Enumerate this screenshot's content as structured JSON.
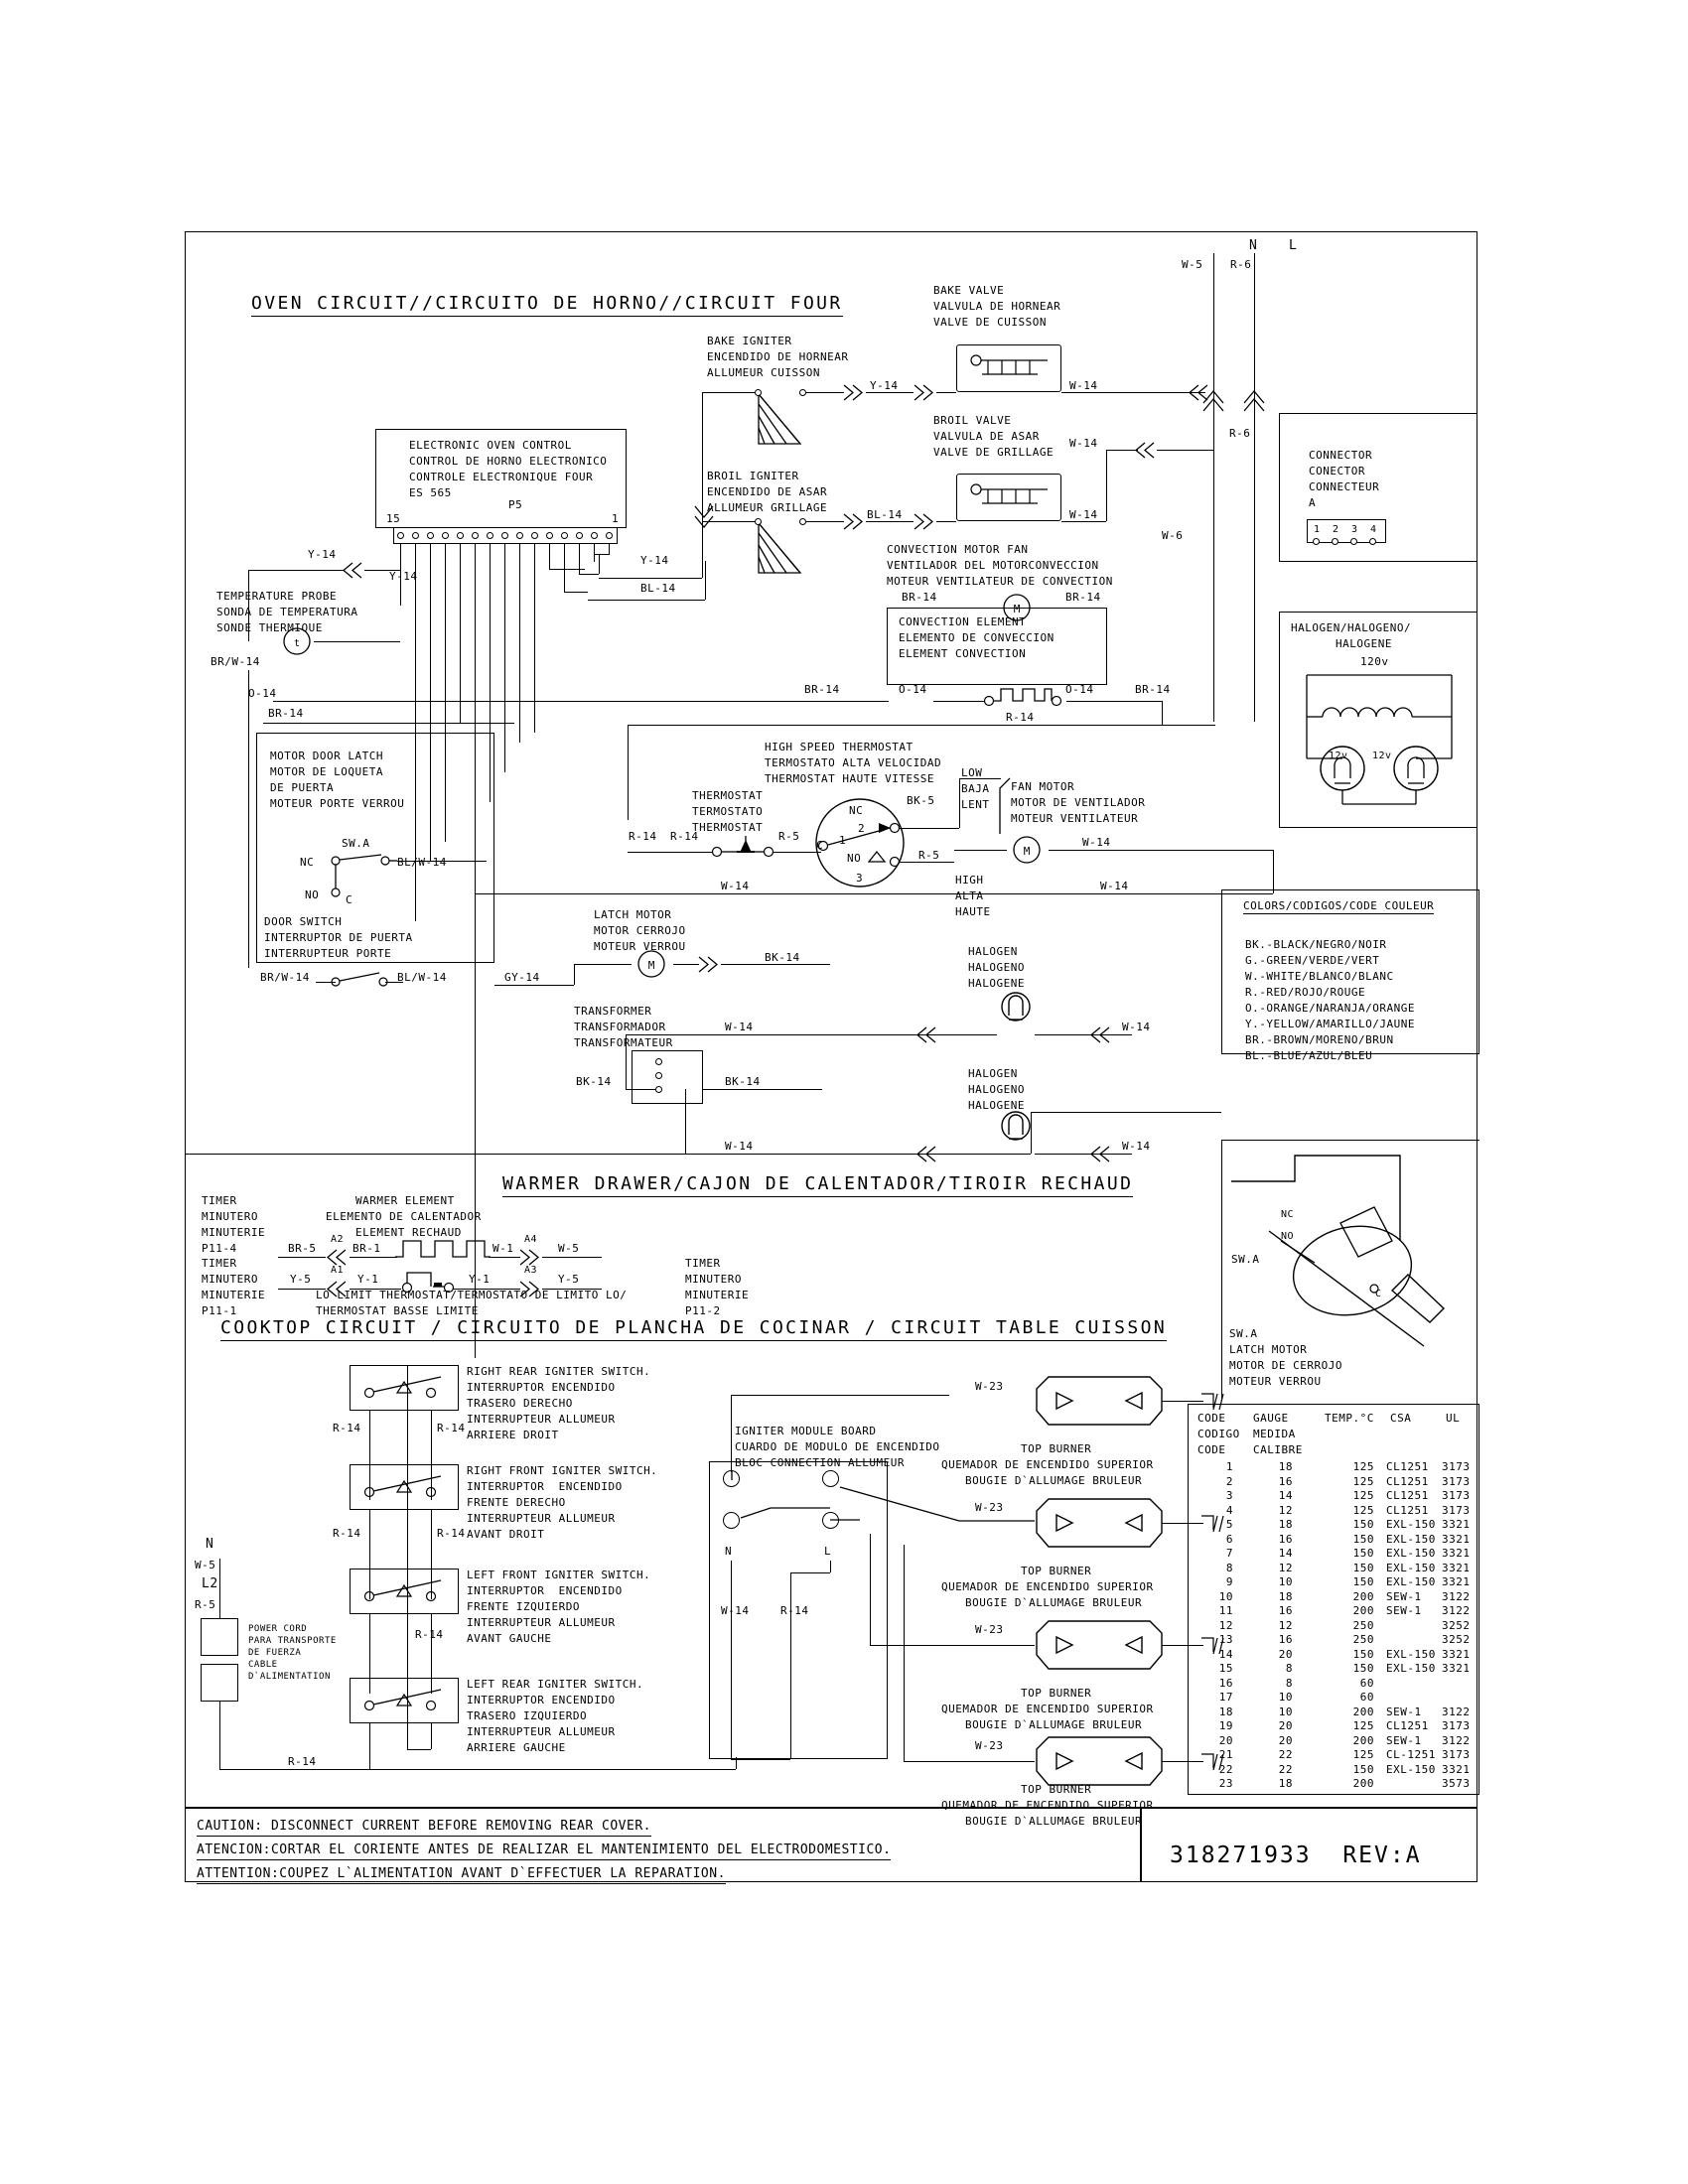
{
  "document": {
    "part_number": "318271933  REV:A",
    "caution_lines": [
      "CAUTION: DISCONNECT CURRENT BEFORE REMOVING REAR COVER.",
      "ATENCION:CORTAR EL CORIENTE ANTES DE REALIZAR EL MANTENIMIENTO DEL ELECTRODOMESTICO.",
      "ATTENTION:COUPEZ L`ALIMENTATION AVANT D`EFFECTUER LA REPARATION."
    ]
  },
  "sections": {
    "oven": "OVEN CIRCUIT//CIRCUITO DE HORNO//CIRCUIT FOUR",
    "warmer": "WARMER DRAWER/CAJON DE CALENTADOR/TIROIR RECHAUD",
    "cooktop": "COOKTOP CIRCUIT / CIRCUITO DE PLANCHA DE COCINAR / CIRCUIT TABLE CUISSON"
  },
  "supply": {
    "n": "N",
    "l": "L",
    "w5": "W-5",
    "r6": "R-6",
    "r6b": "R-6",
    "w6": "W-6"
  },
  "control": {
    "lines": [
      "ELECTRONIC OVEN CONTROL",
      "CONTROL DE HORNO ELECTRONICO",
      "CONTROLE ELECTRONIQUE FOUR",
      "ES 565"
    ],
    "pin_left": "15",
    "pin_right": "1",
    "connector_label": "P5"
  },
  "oven_labels": {
    "bake_igniter": [
      "BAKE IGNITER",
      "ENCENDIDO DE HORNEAR",
      "ALLUMEUR CUISSON"
    ],
    "broil_igniter": [
      "BROIL IGNITER",
      "ENCENDIDO DE ASAR",
      "ALLUMEUR GRILLAGE"
    ],
    "bake_valve": [
      "BAKE VALVE",
      "VALVULA DE HORNEAR",
      "VALVE DE CUISSON"
    ],
    "broil_valve": [
      "BROIL VALVE",
      "VALVULA DE ASAR",
      "VALVE DE GRILLAGE"
    ],
    "convection_motor": [
      "CONVECTION MOTOR FAN",
      "VENTILADOR DEL MOTORCONVECCION",
      "MOTEUR VENTILATEUR DE CONVECTION"
    ],
    "convection_element": [
      "CONVECTION ELEMENT",
      "ELEMENTO DE CONVECCION",
      "ELEMENT CONVECTION"
    ],
    "temperature_probe": [
      "TEMPERATURE PROBE",
      "SONDA DE TEMPERATURA",
      "SONDE THERMIQUE"
    ],
    "motor_door_latch": [
      "MOTOR DOOR LATCH",
      "MOTOR DE LOQUETA",
      "DE PUERTA",
      "MOTEUR PORTE VERROU"
    ],
    "door_switch": [
      "DOOR SWITCH",
      "INTERRUPTOR DE PUERTA",
      "INTERRUPTEUR PORTE"
    ],
    "latch_motor": [
      "LATCH MOTOR",
      "MOTOR CERROJO",
      "MOTEUR VERROU"
    ],
    "transformer": [
      "TRANSFORMER",
      "TRANSFORMADOR",
      "TRANSFORMATEUR"
    ],
    "high_speed_thermostat": [
      "HIGH SPEED THERMOSTAT",
      "TERMOSTATO ALTA VELOCIDAD",
      "THERMOSTAT HAUTE VITESSE"
    ],
    "thermostat": [
      "THERMOSTAT",
      "TERMOSTATO",
      "THERMOSTAT"
    ],
    "fan_motor": [
      "FAN MOTOR",
      "MOTOR DE VENTILADOR",
      "MOTEUR VENTILATEUR"
    ],
    "low": [
      "LOW",
      "BAJA",
      "LENT"
    ],
    "high": [
      "HIGH",
      "ALTA",
      "HAUTE"
    ],
    "halogen": [
      "HALOGEN",
      "HALOGENO",
      "HALOGENE"
    ],
    "sw_a": "SW.A",
    "nc": "NC",
    "no": "NO",
    "c": "C",
    "t": "t",
    "node_c": "C",
    "node_1": "1",
    "node_2": "2",
    "node_3": "3"
  },
  "wires": {
    "y14": "Y-14",
    "bl14": "BL-14",
    "w14": "W-14",
    "br14": "BR-14",
    "o14": "O-14",
    "r14": "R-14",
    "r5": "R-5",
    "bk5": "BK-5",
    "bk14": "BK-14",
    "gy14": "GY-14",
    "brw14": "BR/W-14",
    "blw14": "BL/W-14",
    "w23": "W-23",
    "w1": "W-1",
    "w5": "W-5",
    "y5": "Y-5",
    "y1": "Y-1",
    "br5": "BR-5",
    "br1": "BR-1",
    "r6": "R-6"
  },
  "connector_box": {
    "lines": [
      "CONNECTOR",
      "CONECTOR",
      "CONNECTEUR",
      "A"
    ],
    "pins": [
      "1",
      "2",
      "3",
      "4"
    ]
  },
  "halogen_box": {
    "title": "HALOGEN/HALOGENO/",
    "title2": "HALOGENE",
    "voltage": "120v",
    "v_left": "12v",
    "v_right": "12v"
  },
  "colors_legend": {
    "title": "COLORS/CODIGOS/CODE COULEUR",
    "items": [
      "BK.-BLACK/NEGRO/NOIR",
      "G.-GREEN/VERDE/VERT",
      "W.-WHITE/BLANCO/BLANC",
      "R.-RED/ROJO/ROUGE",
      "O.-ORANGE/NARANJA/ORANGE",
      "Y.-YELLOW/AMARILLO/JAUNE",
      "BR.-BROWN/MORENO/BRUN",
      "BL.-BLUE/AZUL/BLEU"
    ]
  },
  "latch_detail": {
    "sw_a": "SW.A",
    "sw_a2": "SW.A",
    "nc": "NC",
    "no": "NO",
    "c": "C",
    "lines": [
      "LATCH MOTOR",
      "MOTOR DE CERROJO",
      "MOTEUR VERROU"
    ]
  },
  "warmer": {
    "timer1": [
      "TIMER",
      "MINUTERO",
      "MINUTERIE",
      "P11-4"
    ],
    "timer2": [
      "TIMER",
      "MINUTERO",
      "MINUTERIE",
      "P11-1"
    ],
    "timer3": [
      "TIMER",
      "MINUTERO",
      "MINUTERIE",
      "P11-2"
    ],
    "element": [
      "WARMER ELEMENT",
      "ELEMENTO DE CALENTADOR",
      "ELEMENT RECHAUD"
    ],
    "lo_limit": [
      "LO LIMIT THERMOSTAT/TERMOSTATO DE LIMITO LO/",
      "THERMOSTAT BASSE LIMITE"
    ],
    "a1": "A1",
    "a2": "A2",
    "a3": "A3",
    "a4": "A4"
  },
  "cooktop": {
    "power": {
      "n": "N",
      "w5": "W-5",
      "l2": "L2",
      "r5": "R-5",
      "cord": [
        "POWER CORD",
        "PARA TRANSPORTE",
        "DE FUERZA",
        "CABLE",
        "D`ALIMENTATION"
      ]
    },
    "switches": [
      {
        "lines": [
          "RIGHT REAR IGNITER SWITCH.",
          "INTERRUPTOR ENCENDIDO",
          "TRASERO DERECHO",
          "INTERRUPTEUR ALLUMEUR",
          "ARRIERE DROIT"
        ]
      },
      {
        "lines": [
          "RIGHT FRONT IGNITER SWITCH.",
          "INTERRUPTOR  ENCENDIDO",
          "FRENTE DERECHO",
          "INTERRUPTEUR ALLUMEUR",
          "AVANT DROIT"
        ]
      },
      {
        "lines": [
          "LEFT FRONT IGNITER SWITCH.",
          "INTERRUPTOR  ENCENDIDO",
          "FRENTE IZQUIERDO",
          "INTERRUPTEUR ALLUMEUR",
          "AVANT GAUCHE"
        ]
      },
      {
        "lines": [
          "LEFT REAR IGNITER SWITCH.",
          "INTERRUPTOR ENCENDIDO",
          "TRASERO IZQUIERDO",
          "INTERRUPTEUR ALLUMEUR",
          "ARRIERE GAUCHE"
        ]
      }
    ],
    "module": {
      "lines": [
        "IGNITER MODULE BOARD",
        "CUARDO DE MODULO DE ENCENDIDO",
        "BLOC CONNECTION ALLUMEUR"
      ],
      "n": "N",
      "l": "L",
      "w14": "W-14",
      "r14": "R-14"
    },
    "burner": [
      "TOP BURNER",
      "QUEMADOR DE ENCENDIDO SUPERIOR",
      "BOUGIE D`ALLUMAGE BRULEUR"
    ]
  },
  "gauge_table": {
    "headers": [
      "CODE",
      "GAUGE",
      "TEMP.°C",
      "CSA",
      "UL"
    ],
    "subheaders1": [
      "CODIGO",
      "MEDIDA"
    ],
    "subheaders2": [
      "CODE",
      "CALIBRE"
    ],
    "rows": [
      [
        "1",
        "18",
        "125",
        "CL1251",
        "3173"
      ],
      [
        "2",
        "16",
        "125",
        "CL1251",
        "3173"
      ],
      [
        "3",
        "14",
        "125",
        "CL1251",
        "3173"
      ],
      [
        "4",
        "12",
        "125",
        "CL1251",
        "3173"
      ],
      [
        "5",
        "18",
        "150",
        "EXL-150",
        "3321"
      ],
      [
        "6",
        "16",
        "150",
        "EXL-150",
        "3321"
      ],
      [
        "7",
        "14",
        "150",
        "EXL-150",
        "3321"
      ],
      [
        "8",
        "12",
        "150",
        "EXL-150",
        "3321"
      ],
      [
        "9",
        "10",
        "150",
        "EXL-150",
        "3321"
      ],
      [
        "10",
        "18",
        "200",
        "SEW-1",
        "3122"
      ],
      [
        "11",
        "16",
        "200",
        "SEW-1",
        "3122"
      ],
      [
        "12",
        "12",
        "250",
        "",
        "3252"
      ],
      [
        "13",
        "16",
        "250",
        "",
        "3252"
      ],
      [
        "14",
        "20",
        "150",
        "EXL-150",
        "3321"
      ],
      [
        "15",
        "8",
        "150",
        "EXL-150",
        "3321"
      ],
      [
        "16",
        "8",
        "60",
        "",
        ""
      ],
      [
        "17",
        "10",
        "60",
        "",
        ""
      ],
      [
        "18",
        "10",
        "200",
        "SEW-1",
        "3122"
      ],
      [
        "19",
        "20",
        "125",
        "CL1251",
        "3173"
      ],
      [
        "20",
        "20",
        "200",
        "SEW-1",
        "3122"
      ],
      [
        "21",
        "22",
        "125",
        "CL-1251",
        "3173"
      ],
      [
        "22",
        "22",
        "150",
        "EXL-150",
        "3321"
      ],
      [
        "23",
        "18",
        "200",
        "",
        "3573"
      ]
    ]
  }
}
